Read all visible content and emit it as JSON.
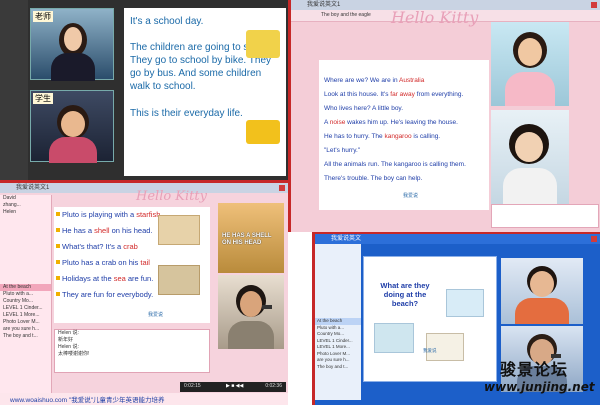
{
  "window1": {
    "teacher_label": "老师",
    "student_label": "学生",
    "slide": {
      "line1": "It's a school day.",
      "line2": "The children are going to school.",
      "line3": "They go to school by bike. They",
      "line4": "go by bus. And some children",
      "line5": "walk to school.",
      "line6": "This is their everyday life."
    }
  },
  "window2": {
    "title": "我爱说英文1",
    "tab": "The boy and the eagle",
    "brand": "Hello Kitty",
    "slide": {
      "l1_a": "Where are we? We are in ",
      "l1_b": "Australia",
      "l2_a": "Look at this house. It's ",
      "l2_b": "far away",
      "l2_c": " from everything.",
      "l3": "Who lives here? A little boy.",
      "l4_a": "A ",
      "l4_b": "noise",
      "l4_c": " wakes him up. He's leaving the house.",
      "l5_a": "He has to hurry. The ",
      "l5_b": "kangaroo",
      "l5_c": " is calling.",
      "l6": "\"Let's hurry.\"",
      "l7": "All the animals run. The kangaroo is calling them.",
      "l8": "There's trouble. The boy can help."
    },
    "logo": "我爱说"
  },
  "window3": {
    "title": "我爱说英文1",
    "brand": "Hello Kitty",
    "users": [
      "David",
      "zhang...",
      "Helen"
    ],
    "courses": [
      "At the beach",
      "Pluto with a...",
      "Country Mo...",
      "LEVEL 1 Cinder...",
      "LEVEL 1 More...",
      "Photo Lover M...",
      "are you sure h...",
      "The boy and t..."
    ],
    "slide": {
      "l1_a": "Pluto is playing with a ",
      "l1_b": "starfish",
      "l2_a": "He has a ",
      "l2_b": "shell",
      "l2_c": " on his head.",
      "l3_a": "What's that? It's a ",
      "l3_b": "crab",
      "l4_a": "Pluto has a crab on his ",
      "l4_b": "tail",
      "l5_a": "Holidays at the ",
      "l5_b": "sea",
      "l5_c": " are fun.",
      "l6": "They are fun for everybody."
    },
    "video_caption_1": "HE HAS A SHELL",
    "video_caption_2": "ON HIS HEAD",
    "chat": [
      "Helen 说:",
      "新年好",
      "Helen 说:",
      "太棒喽谢谢你!"
    ],
    "time_start": "0:02:15",
    "time_end": "0:02:36",
    "logo": "我爱说",
    "footer": "www.woaishuo.com  \"我爱说\"儿童青少年英语能力培养"
  },
  "window4": {
    "title": "我爱说英文",
    "courses": [
      "At the beach",
      "Pluto with a...",
      "Country Mo...",
      "LEVEL 1 Cinder...",
      "LEVEL 1 More...",
      "Photo Lover M...",
      "are you sure h...",
      "The boy and t..."
    ],
    "question": "What are they doing at the beach?",
    "logo": "我爱说"
  },
  "watermark": {
    "line1": "骏景论坛",
    "line2": "www.junjing.net"
  }
}
